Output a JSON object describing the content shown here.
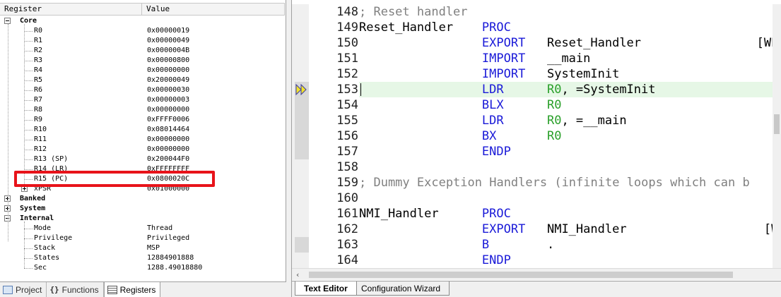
{
  "registers": {
    "header": {
      "name": "Register",
      "value": "Value"
    },
    "groups": {
      "core": "Core",
      "banked": "Banked",
      "system": "System",
      "internal": "Internal"
    },
    "core_rows": [
      {
        "name": "R0",
        "value": "0x00000019"
      },
      {
        "name": "R1",
        "value": "0x00000049"
      },
      {
        "name": "R2",
        "value": "0x0000004B"
      },
      {
        "name": "R3",
        "value": "0x00000800"
      },
      {
        "name": "R4",
        "value": "0x00000000"
      },
      {
        "name": "R5",
        "value": "0x20000049"
      },
      {
        "name": "R6",
        "value": "0x00000030"
      },
      {
        "name": "R7",
        "value": "0x00000003"
      },
      {
        "name": "R8",
        "value": "0x00000000"
      },
      {
        "name": "R9",
        "value": "0xFFFF0006"
      },
      {
        "name": "R10",
        "value": "0x08014464"
      },
      {
        "name": "R11",
        "value": "0x00000000"
      },
      {
        "name": "R12",
        "value": "0x00000000"
      },
      {
        "name": "R13 (SP)",
        "value": "0x200044F0"
      },
      {
        "name": "R14 (LR)",
        "value": "0xFFFFFFFF"
      },
      {
        "name": "R15 (PC)",
        "value": "0x0800020C"
      },
      {
        "name": "xPSR",
        "value": "0x01000000"
      }
    ],
    "internal_rows": [
      {
        "name": "Mode",
        "value": "Thread"
      },
      {
        "name": "Privilege",
        "value": "Privileged"
      },
      {
        "name": "Stack",
        "value": "MSP"
      },
      {
        "name": "States",
        "value": "12884901888"
      },
      {
        "name": "Sec",
        "value": "1288.49018880"
      }
    ]
  },
  "left_tabs": [
    {
      "label": "Project",
      "icon": "project-icon"
    },
    {
      "label": "Functions",
      "icon": "functions-icon"
    },
    {
      "label": "Registers",
      "icon": "registers-icon"
    }
  ],
  "editor": {
    "lines": [
      {
        "num": "148",
        "tokens": [
          {
            "t": "; Reset handler",
            "c": "cm",
            "col": 0
          }
        ]
      },
      {
        "num": "149",
        "tokens": [
          {
            "t": "Reset_Handler",
            "c": "tx",
            "col": 0
          },
          {
            "t": "PROC",
            "c": "kw",
            "col": 17
          }
        ]
      },
      {
        "num": "150",
        "tokens": [
          {
            "t": "EXPORT",
            "c": "kw",
            "col": 17
          },
          {
            "t": "Reset_Handler",
            "c": "tx",
            "col": 26
          },
          {
            "t": "[WE",
            "c": "tx",
            "col": 55
          }
        ]
      },
      {
        "num": "151",
        "tokens": [
          {
            "t": "IMPORT",
            "c": "kw",
            "col": 17
          },
          {
            "t": "__main",
            "c": "tx",
            "col": 26
          }
        ]
      },
      {
        "num": "152",
        "tokens": [
          {
            "t": "IMPORT",
            "c": "kw",
            "col": 17
          },
          {
            "t": "SystemInit",
            "c": "tx",
            "col": 26
          }
        ]
      },
      {
        "num": "153",
        "current": true,
        "tokens": [
          {
            "t": "LDR",
            "c": "kw",
            "col": 17
          },
          {
            "t": "R0",
            "c": "reg",
            "col": 26
          },
          {
            "t": ", =SystemInit",
            "c": "tx",
            "col": 28
          }
        ]
      },
      {
        "num": "154",
        "tokens": [
          {
            "t": "BLX",
            "c": "kw",
            "col": 17
          },
          {
            "t": "R0",
            "c": "reg",
            "col": 26
          }
        ]
      },
      {
        "num": "155",
        "tokens": [
          {
            "t": "LDR",
            "c": "kw",
            "col": 17
          },
          {
            "t": "R0",
            "c": "reg",
            "col": 26
          },
          {
            "t": ", =__main",
            "c": "tx",
            "col": 28
          }
        ]
      },
      {
        "num": "156",
        "tokens": [
          {
            "t": "BX",
            "c": "kw",
            "col": 17
          },
          {
            "t": "R0",
            "c": "reg",
            "col": 26
          }
        ]
      },
      {
        "num": "157",
        "tokens": [
          {
            "t": "ENDP",
            "c": "kw",
            "col": 17
          }
        ]
      },
      {
        "num": "158",
        "tokens": []
      },
      {
        "num": "159",
        "tokens": [
          {
            "t": "; Dummy Exception Handlers (infinite loops which can b",
            "c": "cm",
            "col": 0
          }
        ]
      },
      {
        "num": "160",
        "tokens": []
      },
      {
        "num": "161",
        "tokens": [
          {
            "t": "NMI_Handler",
            "c": "tx",
            "col": 0
          },
          {
            "t": "PROC",
            "c": "kw",
            "col": 17
          }
        ]
      },
      {
        "num": "162",
        "tokens": [
          {
            "t": "EXPORT",
            "c": "kw",
            "col": 17
          },
          {
            "t": "NMI_Handler",
            "c": "tx",
            "col": 26
          },
          {
            "t": "[W",
            "c": "tx",
            "col": 56
          }
        ]
      },
      {
        "num": "163",
        "tokens": [
          {
            "t": "B",
            "c": "kw",
            "col": 17
          },
          {
            "t": ".",
            "c": "tx",
            "col": 26
          }
        ]
      },
      {
        "num": "164",
        "tokens": [
          {
            "t": "ENDP",
            "c": "kw",
            "col": 17
          }
        ]
      }
    ]
  },
  "right_tabs": [
    {
      "label": "Text Editor"
    },
    {
      "label": "Configuration Wizard"
    }
  ],
  "colors": {
    "comment": "#808080",
    "keyword": "#1a1ad8",
    "register": "#2aa02a",
    "current_line": "#e6f7e6",
    "highlight_box": "#e8131a",
    "execution_arrow": "#f2e22a"
  }
}
